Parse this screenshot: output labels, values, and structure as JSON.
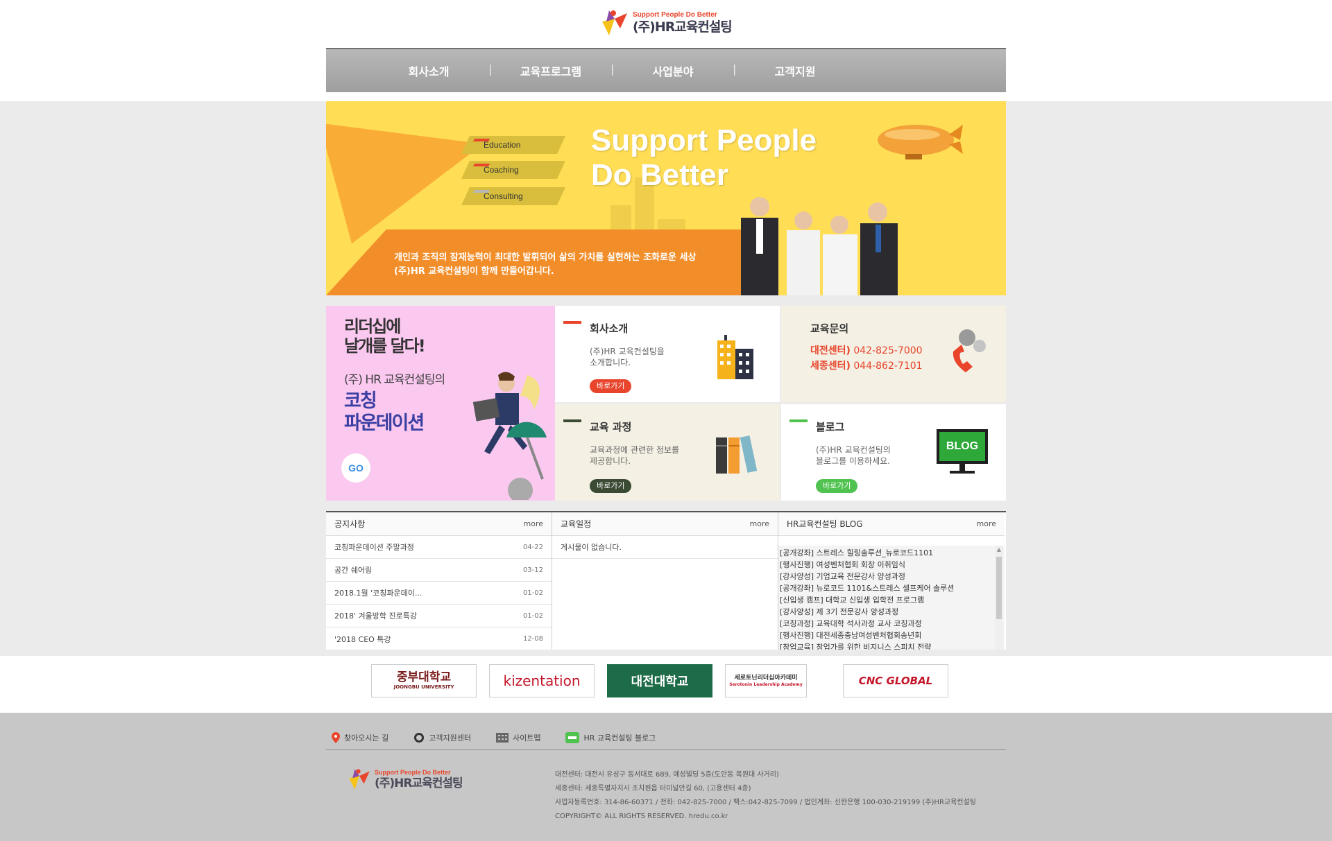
{
  "brand": {
    "tagline": "Support People Do Better",
    "name": "(주)HR교육컨설팅"
  },
  "gnb": [
    "회사소개",
    "교육프로그램",
    "사업분야",
    "고객지원"
  ],
  "banner": {
    "tags": [
      "Education",
      "Coaching",
      "Consulting"
    ],
    "title_line1": "Support People",
    "title_line2": "Do Better",
    "copy_line1": "개인과 조직의 잠재능력이 최대한 발휘되어 삶의 가치를 실현하는 조화로운 세상",
    "copy_line2": "(주)HR 교육컨설팅이 함께 만들어갑니다."
  },
  "promo": {
    "line1a": "리더십에",
    "line1b": "날개를 달다!",
    "line2": "(주) HR 교육컨설팅의",
    "line3a": "코칭",
    "line3b": "파운데이션",
    "go": "GO"
  },
  "tiles": {
    "about": {
      "title": "회사소개",
      "desc1": "(주)HR 교육컨설팅을",
      "desc2": "소개합니다.",
      "btn": "바로가기"
    },
    "inquiry": {
      "title": "교육문의",
      "line1_label": "대전센터)",
      "line1_value": "042-825-7000",
      "line2_label": "세종센터)",
      "line2_value": "044-862-7101"
    },
    "course": {
      "title": "교육 과정",
      "desc1": "교육과정에 관련한 정보를",
      "desc2": "제공합니다.",
      "btn": "바로가기"
    },
    "blog": {
      "title": "블로그",
      "desc1": "(주)HR 교육컨설팅의",
      "desc2": "블로그를 이용하세요.",
      "btn": "바로가기",
      "icon_label": "BLOG"
    }
  },
  "boards": {
    "notice": {
      "title": "공지사항",
      "more": "more",
      "rows": [
        {
          "title": "코칭파운데이션 주말과정",
          "date": "04-22"
        },
        {
          "title": "공간 쉐어링",
          "date": "03-12"
        },
        {
          "title": "2018.1월 '코칭파운데이...",
          "date": "01-02"
        },
        {
          "title": "2018' 겨울방학 진로특강",
          "date": "01-02"
        },
        {
          "title": "'2018 CEO 특강",
          "date": "12-08"
        }
      ]
    },
    "schedule": {
      "title": "교육일정",
      "more": "more",
      "empty": "게시물이 없습니다."
    },
    "blog": {
      "title": "HR교육컨설팅 BLOG",
      "more": "more",
      "items": [
        "[공개강좌] 스트레스 힐링솔루션_뉴로코드1101",
        "[행사진행] 여성벤처협회 회장 이취임식",
        "[강사양성] 기업교육 전문강사 양성과정",
        "[공개강좌] 뉴로코드 1101&스트레스 셀프케어 솔루션",
        "[신입생 캠프] 대학교 신입생 입학전 프로그램",
        "[강사양성] 제 3기 전문강사 양성과정",
        "[코칭과정] 교육대학 석사과정 교사 코칭과정",
        "[행사진행] 대전세종충남여성벤처협회송년회",
        "[창업교육] 창업가를 위한 비지니스 스피치 전략"
      ]
    }
  },
  "partners": [
    {
      "label": "중부대학교",
      "sub": "JOONGBU UNIVERSITY",
      "color": "#7a1c1c"
    },
    {
      "label": "kizentation",
      "sub": "",
      "color": "#c4162a"
    },
    {
      "label": "대전대학교",
      "sub": "",
      "color": "#ffffff"
    },
    {
      "label": "세로토닌리더십아카데미",
      "sub": "Serotonin Leadership Academy",
      "color": "#333333"
    },
    {
      "label": "CNC GLOBAL",
      "sub": "",
      "color": "#c4162a"
    }
  ],
  "footer": {
    "nav": [
      "찾아오시는 길",
      "고객지원센터",
      "사이트맵",
      "HR 교육컨설팅 블로그"
    ],
    "info": [
      "대전센터: 대전시 유성구 동서대로 689, 예성빌딩 5층(도안동 목원대 사거리)",
      "세종센터: 세종특별자치시 조치원읍 터미널안길 60, (고용센터 4층)",
      "사업자등록번호: 314-86-60371 / 전화: 042-825-7000 / 팩스:042-825-7099 / 법인계좌: 신한은행 100-030-219199 (주)HR교육컨설팅",
      "COPYRIGHT© ALL RIGHTS RESERVED. hredu.co.kr"
    ]
  },
  "colors": {
    "accent_red": "#e8452c",
    "accent_green": "#4fc24f",
    "dark_green": "#3b4a33",
    "banner_yellow": "#ffdd55"
  }
}
